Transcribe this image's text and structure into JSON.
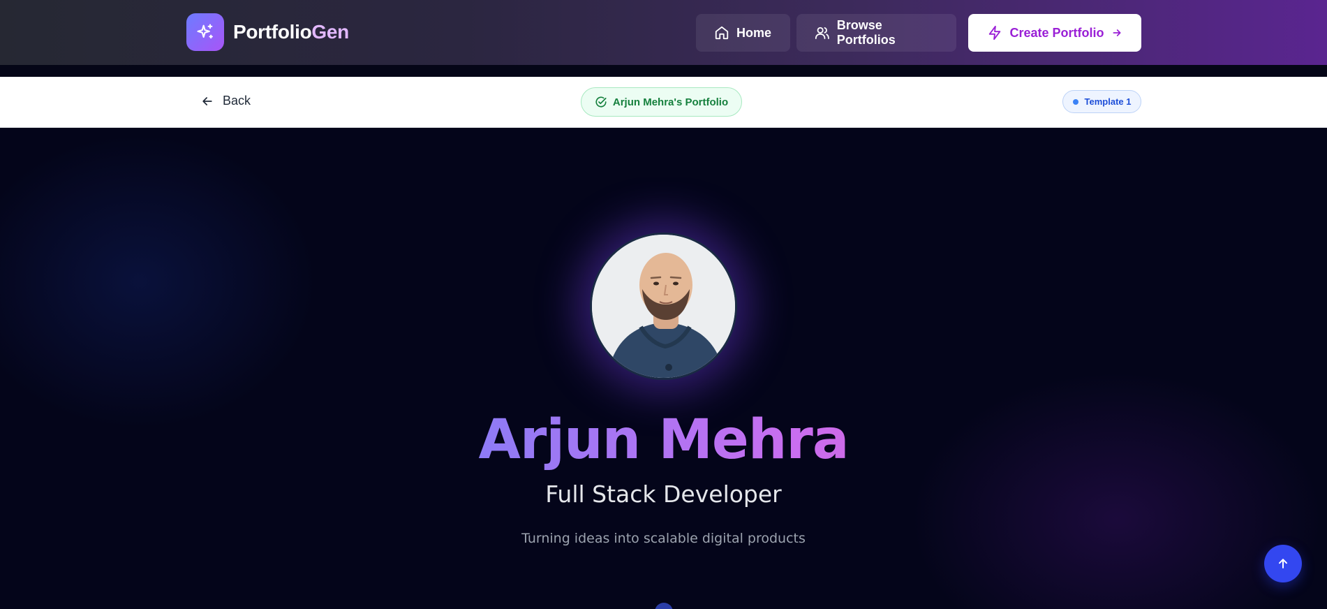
{
  "navbar": {
    "brand_main": "Portfolio",
    "brand_accent": "Gen",
    "home_label": "Home",
    "browse_label": "Browse Portfolios",
    "create_label": "Create Portfolio"
  },
  "subheader": {
    "back_label": "Back",
    "portfolio_label": "Arjun Mehra's Portfolio",
    "template_label": "Template 1"
  },
  "hero": {
    "name": "Arjun Mehra",
    "role": "Full Stack Developer",
    "tagline": "Turning ideas into scalable digital products"
  },
  "colors": {
    "brand_accent": "#e2b8ff",
    "create_text": "#9a1fd6",
    "success": "#15803d",
    "template_blue": "#1d4ed8",
    "scroll_top_button": "#3347f0"
  },
  "icons": {
    "logo": "sparkles-icon",
    "home": "home-icon",
    "browse": "users-icon",
    "create": "lightning-icon",
    "back": "arrow-left-icon",
    "portfolio_status": "check-circle-icon",
    "scroll_top": "arrow-up-icon"
  }
}
